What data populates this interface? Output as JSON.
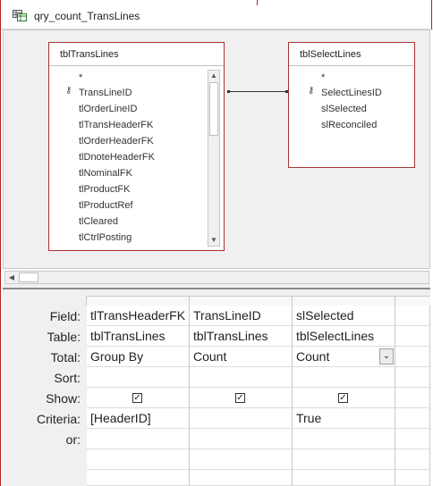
{
  "window": {
    "title": "qry_count_TransLines"
  },
  "tables": [
    {
      "name": "tblTransLines",
      "fields": [
        "*",
        "TransLineID",
        "tlOrderLineID",
        "tlTransHeaderFK",
        "tlOrderHeaderFK",
        "tlDnoteHeaderFK",
        "tlNominalFK",
        "tlProductFK",
        "tlProductRef",
        "tlCleared",
        "tlCtrlPosting"
      ],
      "key_field_index": 1
    },
    {
      "name": "tblSelectLines",
      "fields": [
        "*",
        "SelectLinesID",
        "slSelected",
        "slReconciled"
      ],
      "key_field_index": 1
    }
  ],
  "grid": {
    "row_labels": [
      "Field:",
      "Table:",
      "Total:",
      "Sort:",
      "Show:",
      "Criteria:",
      "or:"
    ],
    "columns": [
      {
        "field": "tlTransHeaderFK",
        "table": "tblTransLines",
        "total": "Group By",
        "sort": "",
        "show": true,
        "criteria": "[HeaderID]",
        "or": ""
      },
      {
        "field": "TransLineID",
        "table": "tblTransLines",
        "total": "Count",
        "sort": "",
        "show": true,
        "criteria": "",
        "or": ""
      },
      {
        "field": "slSelected",
        "table": "tblSelectLines",
        "total": "Count",
        "sort": "",
        "show": true,
        "criteria": "True",
        "or": ""
      },
      {
        "field": "",
        "table": "",
        "total": "",
        "sort": "",
        "show": false,
        "criteria": "",
        "or": ""
      }
    ]
  },
  "icons": {
    "query": "query-icon",
    "key": "primary-key-icon",
    "check": "checkmark"
  },
  "colors": {
    "table_border": "#a83232",
    "accent_red": "#b22222",
    "pane_bg": "#f0f0f0"
  }
}
